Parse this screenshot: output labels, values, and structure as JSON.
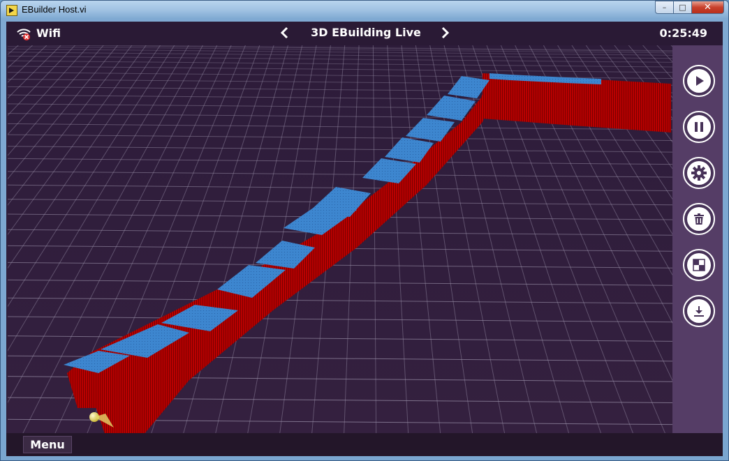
{
  "window": {
    "title": "EBuilder Host.vi",
    "controls": {
      "minimize": "–",
      "maximize": "□",
      "close": "✕"
    }
  },
  "header": {
    "connection_label": "Wifi",
    "connection_icon": "wifi-disconnected-icon",
    "view_title": "3D EBuilding Live",
    "elapsed_time": "0:25:49"
  },
  "sidebar": {
    "buttons": [
      {
        "name": "play",
        "icon": "play-icon"
      },
      {
        "name": "pause",
        "icon": "pause-icon"
      },
      {
        "name": "settings",
        "icon": "gear-icon"
      },
      {
        "name": "delete",
        "icon": "trash-icon"
      },
      {
        "name": "snapshot",
        "icon": "checker-icon"
      },
      {
        "name": "download",
        "icon": "download-icon"
      }
    ]
  },
  "bottom": {
    "menu_label": "Menu"
  },
  "scene": {
    "colors": {
      "background": "#2f1e3a",
      "grid": "#9a90a8",
      "walls": "#c00000",
      "ceiling": "#3a7fc8",
      "sensor": "#f0e070"
    }
  }
}
